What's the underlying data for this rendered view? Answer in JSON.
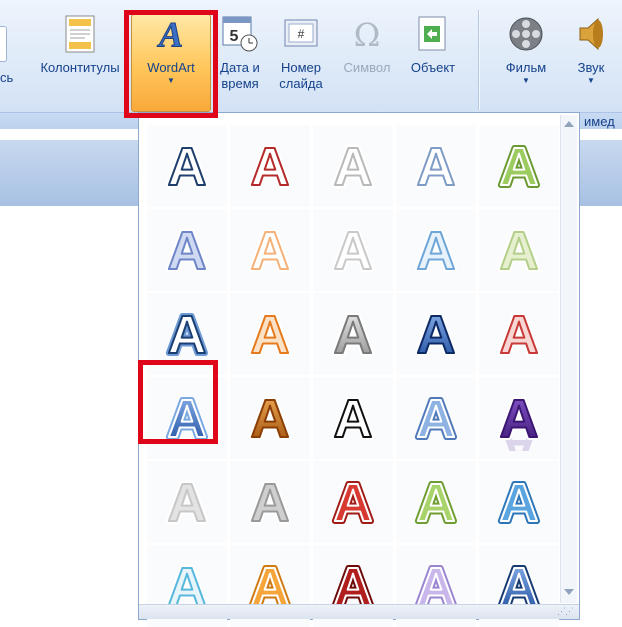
{
  "ribbon": {
    "cut_label": "сь",
    "buttons": [
      {
        "key": "header_footer",
        "label1": "Колонтитулы",
        "label2": ""
      },
      {
        "key": "wordart",
        "label1": "WordArt",
        "label2": ""
      },
      {
        "key": "date_time",
        "label1": "Дата и",
        "label2": "время"
      },
      {
        "key": "slide_number",
        "label1": "Номер",
        "label2": "слайда"
      },
      {
        "key": "symbol",
        "label1": "Символ",
        "label2": ""
      },
      {
        "key": "object",
        "label1": "Объект",
        "label2": ""
      },
      {
        "key": "movie",
        "label1": "Фильм",
        "label2": ""
      },
      {
        "key": "sound",
        "label1": "Звук",
        "label2": ""
      }
    ],
    "group_label_cut": "имед",
    "dropdown_arrow": "▼"
  },
  "gallery": {
    "selected_index": 15,
    "letter": "A",
    "styles": [
      {
        "fill": "#ffffff",
        "stroke": "#1f3f6e",
        "stroke2": "#ffffff",
        "shadow": "none",
        "grad": "plain"
      },
      {
        "fill": "#ffffff",
        "stroke": "#b52b2b",
        "stroke2": "#ffffff",
        "shadow": "none",
        "grad": "plain"
      },
      {
        "fill": "#ffffff",
        "stroke": "#b9b9b9",
        "stroke2": "#ffffff",
        "shadow": "none",
        "grad": "plain"
      },
      {
        "fill": "#ffffff",
        "stroke": "#7f9cc7",
        "stroke2": "#ffffff",
        "shadow": "none",
        "grad": "plain"
      },
      {
        "fill": "#9ccb5f",
        "stroke": "#ffffff",
        "stroke2": "#6b9a32",
        "shadow": "none",
        "grad": "plain"
      },
      {
        "fill": "#cfd9f1",
        "stroke": "#6f86c9",
        "stroke2": "#ffffff",
        "shadow": "none",
        "grad": "plain"
      },
      {
        "fill": "#ffffff",
        "stroke": "#f4b27a",
        "stroke2": "#ffffff",
        "shadow": "none",
        "grad": "plain"
      },
      {
        "fill": "#ffffff",
        "stroke": "#c9c9c9",
        "stroke2": "#ffffff",
        "shadow": "none",
        "grad": "plain"
      },
      {
        "fill": "#e7f2fb",
        "stroke": "#6fa7d9",
        "stroke2": "#ffffff",
        "shadow": "none",
        "grad": "plain"
      },
      {
        "fill": "#e6f0cf",
        "stroke": "#b4cf8b",
        "stroke2": "#ffffff",
        "shadow": "none",
        "grad": "plain"
      },
      {
        "fill": "#ffffff",
        "stroke": "#1b3f73",
        "stroke2": "#6d9ad4",
        "shadow": "none",
        "grad": "plain"
      },
      {
        "fill": "#fbe2c7",
        "stroke": "#e57a1f",
        "stroke2": "#ffffff",
        "shadow": "none",
        "grad": "plain"
      },
      {
        "fill": "#bfbfbf",
        "stroke": "#7a7a7a",
        "stroke2": "#ffffff",
        "shadow": "none",
        "grad": "silver"
      },
      {
        "fill": "#2d5fb0",
        "stroke": "#0b2a66",
        "stroke2": "#ffffff",
        "shadow": "none",
        "grad": "blue"
      },
      {
        "fill": "#f8d6d3",
        "stroke": "#c73a38",
        "stroke2": "#ffffff",
        "shadow": "none",
        "grad": "plain"
      },
      {
        "fill": "#2e64b8",
        "stroke": "#ffffff",
        "stroke2": "#7aa8e0",
        "shadow": "none",
        "grad": "blue"
      },
      {
        "fill": "#d4731a",
        "stroke": "#8a3e05",
        "stroke2": "#ffffff",
        "shadow": "none",
        "grad": "orange"
      },
      {
        "fill": "#ffffff",
        "stroke": "#111111",
        "stroke2": "#ffffff",
        "shadow": "none",
        "grad": "plain"
      },
      {
        "fill": "#8eb2e2",
        "stroke": "#ffffff",
        "stroke2": "#4f79b8",
        "shadow": "none",
        "grad": "plain"
      },
      {
        "fill": "#5a2a9e",
        "stroke": "#3b1672",
        "stroke2": "#ffffff",
        "shadow": "reflect",
        "grad": "purple"
      },
      {
        "fill": "#e3e3e3",
        "stroke": "#c7c7c7",
        "stroke2": "#ffffff",
        "shadow": "none",
        "grad": "plain"
      },
      {
        "fill": "#cfcfcf",
        "stroke": "#9a9a9a",
        "stroke2": "#ffffff",
        "shadow": "none",
        "grad": "plain"
      },
      {
        "fill": "#d83a32",
        "stroke": "#ffffff",
        "stroke2": "#a11c17",
        "shadow": "none",
        "grad": "plain"
      },
      {
        "fill": "#a9d46c",
        "stroke": "#ffffff",
        "stroke2": "#6f9d32",
        "shadow": "none",
        "grad": "plain"
      },
      {
        "fill": "#5aa5e0",
        "stroke": "#ffffff",
        "stroke2": "#2d76b8",
        "shadow": "none",
        "grad": "plain"
      },
      {
        "fill": "#e7f5fb",
        "stroke": "#58b8dc",
        "stroke2": "#ffffff",
        "shadow": "none",
        "grad": "plain"
      },
      {
        "fill": "#f6a53a",
        "stroke": "#ffffff",
        "stroke2": "#d07a12",
        "shadow": "none",
        "grad": "plain"
      },
      {
        "fill": "#b01e1e",
        "stroke": "#ffffff",
        "stroke2": "#6d0b0b",
        "shadow": "none",
        "grad": "plain"
      },
      {
        "fill": "#c9b6ea",
        "stroke": "#ffffff",
        "stroke2": "#9a84cf",
        "shadow": "none",
        "grad": "plain"
      },
      {
        "fill": "#2b5da4",
        "stroke": "#ffffff",
        "stroke2": "#163a72",
        "shadow": "reflect",
        "grad": "blue"
      }
    ]
  },
  "colors": {
    "highlight": "#e0061a",
    "ribbon_text": "#15428b",
    "disabled_text": "#9aa8b8"
  }
}
